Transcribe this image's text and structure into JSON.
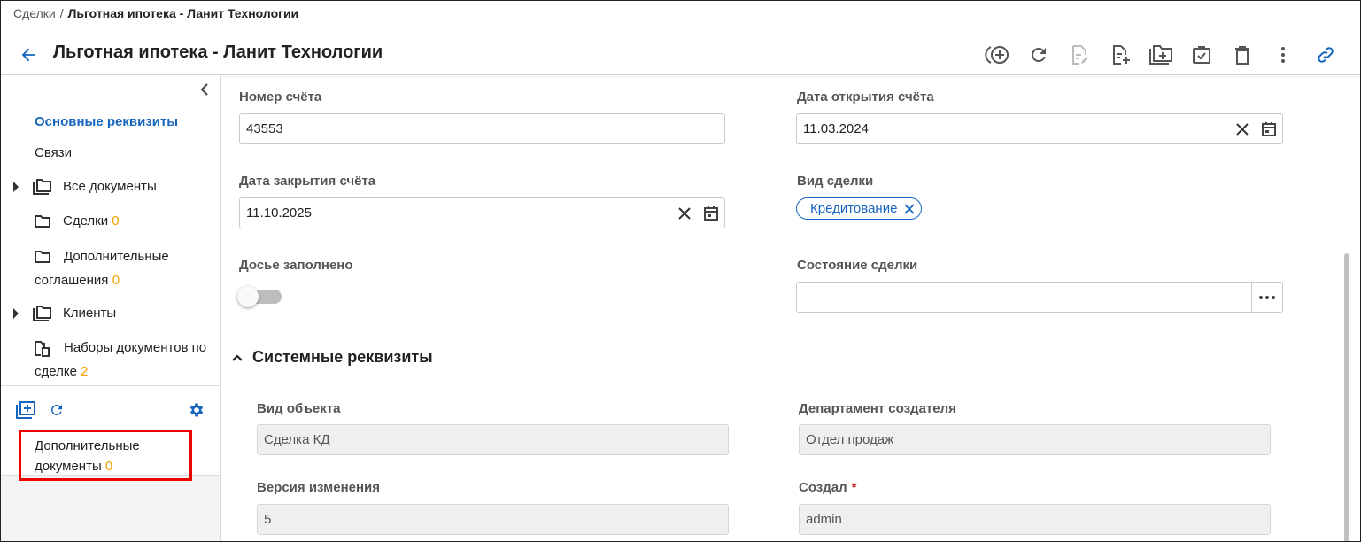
{
  "breadcrumb": {
    "root": "Сделки",
    "separator": "/",
    "current": "Льготная ипотека - Ланит Технологии"
  },
  "header": {
    "title": "Льготная ипотека - Ланит Технологии"
  },
  "toolbar": {
    "icons": [
      "add-circle-icon",
      "refresh-icon",
      "edit-document-icon",
      "new-document-icon",
      "add-folder-icon",
      "task-check-icon",
      "delete-icon",
      "more-vertical-icon",
      "link-icon"
    ]
  },
  "sidebar": {
    "main_requisites": "Основные реквизиты",
    "links": "Связи",
    "all_documents": "Все документы",
    "deals": {
      "label": "Сделки",
      "count": "0"
    },
    "additional_agreements": {
      "label": "Дополнительные соглашения",
      "count": "0"
    },
    "clients": "Клиенты",
    "document_sets": {
      "label": "Наборы документов по сделке",
      "count": "2"
    },
    "additional_documents": {
      "label": "Дополнительные документы",
      "count": "0"
    }
  },
  "form": {
    "account_number": {
      "label": "Номер счёта",
      "value": "43553"
    },
    "account_open_date": {
      "label": "Дата открытия счёта",
      "value": "11.03.2024"
    },
    "account_close_date": {
      "label": "Дата закрытия счёта",
      "value": "11.10.2025"
    },
    "deal_type": {
      "label": "Вид сделки",
      "chip": "Кредитование"
    },
    "dossier_filled": {
      "label": "Досье заполнено",
      "checked": false
    },
    "deal_state": {
      "label": "Состояние сделки",
      "value": ""
    }
  },
  "system": {
    "title": "Системные реквизиты",
    "object_type": {
      "label": "Вид объекта",
      "value": "Сделка КД"
    },
    "creator_department": {
      "label": "Департамент создателя",
      "value": "Отдел продаж"
    },
    "version": {
      "label": "Версия изменения",
      "value": "5"
    },
    "created_by": {
      "label": "Создал",
      "required_mark": "*",
      "value": "admin"
    }
  },
  "colors": {
    "accent": "#1565c0",
    "count": "#f5a000",
    "highlight_border": "#ee0000",
    "required": "#c62828"
  }
}
